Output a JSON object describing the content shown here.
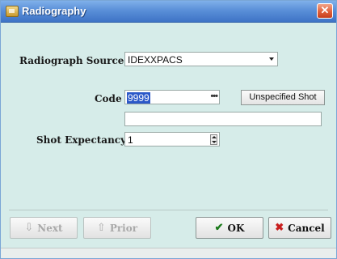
{
  "window": {
    "title": "Radiography",
    "close_glyph": "✕"
  },
  "form": {
    "radiograph_source": {
      "label": "Radiograph Source",
      "value": "IDEXXPACS"
    },
    "code": {
      "label": "Code",
      "value": "9999",
      "lookup_glyph": "•••"
    },
    "unspecified_shot": {
      "label": "Unspecified Shot"
    },
    "description": {
      "value": ""
    },
    "shot_expectancy": {
      "label": "Shot Expectancy",
      "value": "1"
    }
  },
  "buttons": {
    "next": {
      "label": "Next",
      "icon": "down-arrow-icon",
      "glyph": "⇩",
      "enabled": false
    },
    "prior": {
      "label": "Prior",
      "icon": "up-arrow-icon",
      "glyph": "⇧",
      "enabled": false
    },
    "ok": {
      "label": "OK",
      "icon": "check-icon",
      "glyph": "✔",
      "icon_color": "#1a7a1a"
    },
    "cancel": {
      "label": "Cancel",
      "icon": "x-icon",
      "glyph": "✖",
      "icon_color": "#c81e1e"
    }
  },
  "colors": {
    "titlebar": "#3e73c6",
    "background": "#d6ece9",
    "selection": "#2b58c8"
  }
}
